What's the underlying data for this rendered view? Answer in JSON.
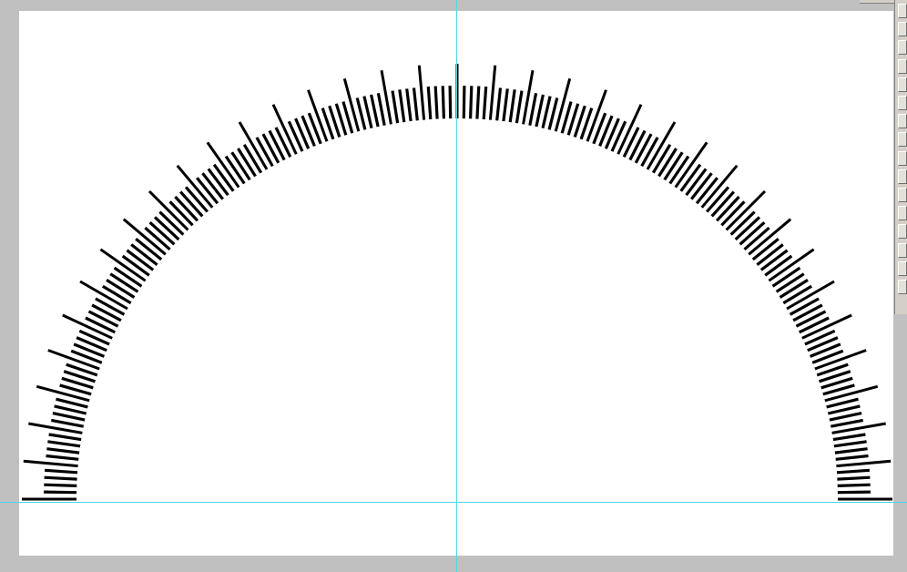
{
  "document": {
    "canvas_background": "#ffffff",
    "pasteboard_color": "#c0c0c0",
    "guide_color": "#4fd8e6",
    "guides": [
      "vertical-guide",
      "horizontal-guide"
    ]
  },
  "dial": {
    "type": "semicircular tick scale",
    "arc_degrees": 180,
    "tick_color": "#000000",
    "total_ticks": 180,
    "major_every": 5,
    "minor_tick": "short",
    "major_tick": "long"
  },
  "side_panel": {
    "slot_count": 16,
    "slot_icon": "checkbox-icon"
  }
}
